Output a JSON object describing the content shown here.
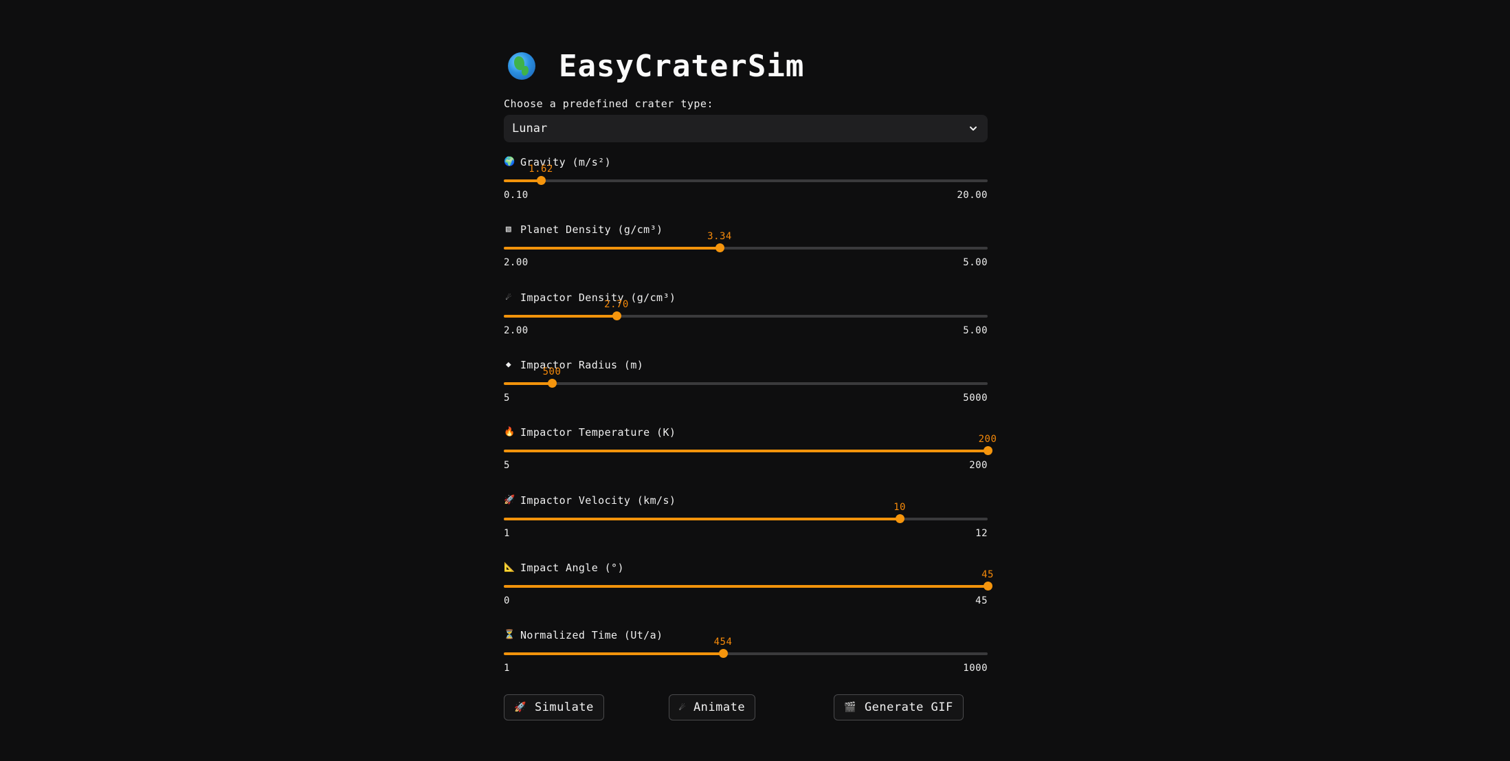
{
  "app": {
    "title": "EasyCraterSim",
    "logo_icon": "globe-africa-icon"
  },
  "crater_select": {
    "label": "Choose a predefined crater type:",
    "value": "Lunar"
  },
  "sliders": [
    {
      "id": "gravity",
      "icon": "🌍",
      "icon_name": "globe-icon",
      "label": "Gravity (m/s²)",
      "value": "1.62",
      "min": "0.10",
      "max": "20.00",
      "fraction": 0.0765
    },
    {
      "id": "planet-density",
      "icon": "▧",
      "icon_name": "planet-density-icon",
      "label": "Planet Density (g/cm³)",
      "value": "3.34",
      "min": "2.00",
      "max": "5.00",
      "fraction": 0.4467
    },
    {
      "id": "impactor-density",
      "icon": "☄",
      "icon_name": "comet-icon",
      "label": "Impactor Density (g/cm³)",
      "value": "2.70",
      "min": "2.00",
      "max": "5.00",
      "fraction": 0.2333
    },
    {
      "id": "impactor-radius",
      "icon": "◆",
      "icon_name": "diamond-icon",
      "label": "Impactor Radius (m)",
      "value": "500",
      "min": "5",
      "max": "5000",
      "fraction": 0.0991
    },
    {
      "id": "impactor-temperature",
      "icon": "🔥",
      "icon_name": "fire-icon",
      "label": "Impactor Temperature (K)",
      "value": "200",
      "min": "5",
      "max": "200",
      "fraction": 1.0
    },
    {
      "id": "impactor-velocity",
      "icon": "🚀",
      "icon_name": "rocket-icon",
      "label": "Impactor Velocity (km/s)",
      "value": "10",
      "min": "1",
      "max": "12",
      "fraction": 0.8182
    },
    {
      "id": "impact-angle",
      "icon": "📐",
      "icon_name": "triangular-ruler-icon",
      "label": "Impact Angle (°)",
      "value": "45",
      "min": "0",
      "max": "45",
      "fraction": 1.0
    },
    {
      "id": "normalized-time",
      "icon": "⏳",
      "icon_name": "hourglass-icon",
      "label": "Normalized Time (Ut/a)",
      "value": "454",
      "min": "1",
      "max": "1000",
      "fraction": 0.4535
    }
  ],
  "buttons": {
    "simulate": {
      "icon": "🚀",
      "icon_name": "rocket-icon",
      "label": "Simulate"
    },
    "animate": {
      "icon": "☄",
      "icon_name": "comet-icon",
      "label": "Animate"
    },
    "gif": {
      "icon": "🎬",
      "icon_name": "clapperboard-icon",
      "label": "Generate GIF"
    }
  },
  "colors": {
    "background": "#0e0e0f",
    "accent": "#f2930b",
    "track": "#3a3a3c",
    "select_bg": "#1f1f21"
  }
}
